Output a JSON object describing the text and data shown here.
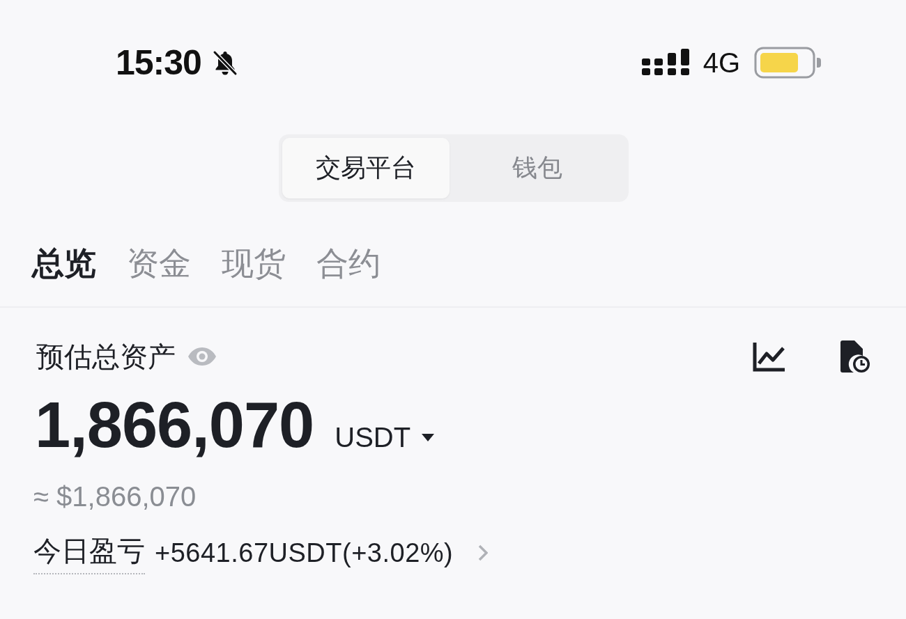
{
  "status_bar": {
    "time": "15:30",
    "network": "4G"
  },
  "account_switch": [
    {
      "label": "交易平台",
      "selected": true
    },
    {
      "label": "钱包",
      "selected": false
    }
  ],
  "tabs": [
    {
      "label": "总览",
      "selected": true
    },
    {
      "label": "资金",
      "selected": false
    },
    {
      "label": "现货",
      "selected": false
    },
    {
      "label": "合约",
      "selected": false
    }
  ],
  "asset_summary": {
    "label": "预估总资产",
    "amount": "1,866,070",
    "currency": "USDT",
    "approx": "≈ $1,866,070"
  },
  "pnl": {
    "label": "今日盈亏",
    "value": "+5641.67USDT(+3.02%)"
  }
}
